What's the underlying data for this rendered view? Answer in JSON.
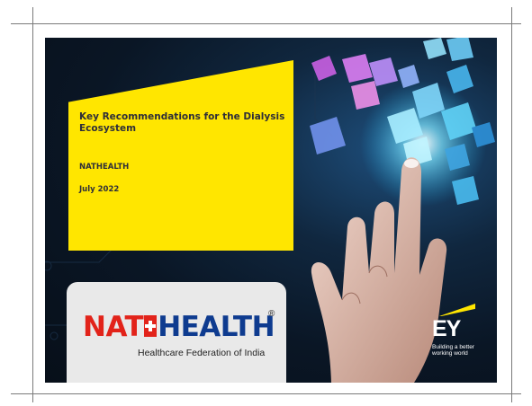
{
  "slide": {
    "title": "Key Recommendations for the Dialysis Ecosystem",
    "organization": "NATHEALTH",
    "date": "July 2022"
  },
  "nathealth_logo": {
    "nat": "NAT",
    "health": "HEALTH",
    "registered": "®",
    "tagline": "Healthcare Federation of India"
  },
  "ey_logo": {
    "letters": "EY",
    "tagline": "Building a better working world"
  },
  "colors": {
    "ey_yellow": "#ffe600",
    "nathealth_red": "#e2231a",
    "nathealth_blue": "#0e3b8f",
    "slide_background": "#0a1625"
  }
}
